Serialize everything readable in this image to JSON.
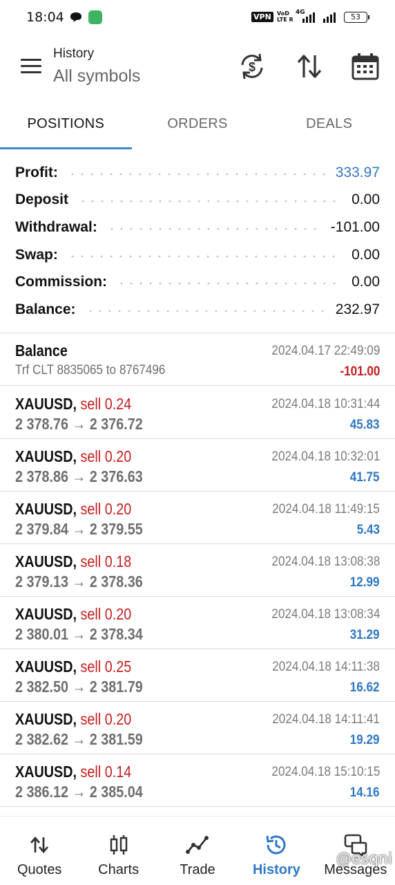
{
  "status_bar": {
    "time": "18:04",
    "vpn": "VPN",
    "volte_top": "VoD",
    "volte_bottom": "LTE R",
    "network": "4G",
    "battery": "53"
  },
  "header": {
    "subtitle": "History",
    "title": "All symbols",
    "icons": [
      "menu-icon",
      "currency-exchange-icon",
      "sort-icon",
      "calendar-icon"
    ]
  },
  "tabs": [
    {
      "label": "POSITIONS",
      "active": true
    },
    {
      "label": "ORDERS",
      "active": false
    },
    {
      "label": "DEALS",
      "active": false
    }
  ],
  "summary": [
    {
      "label": "Profit:",
      "value": "333.97",
      "highlight": true
    },
    {
      "label": "Deposit",
      "value": "0.00"
    },
    {
      "label": "Withdrawal:",
      "value": "-101.00"
    },
    {
      "label": "Swap:",
      "value": "0.00"
    },
    {
      "label": "Commission:",
      "value": "0.00"
    },
    {
      "label": "Balance:",
      "value": "232.97"
    }
  ],
  "balance_entry": {
    "title": "Balance",
    "comment": "Trf CLT 8835065 to 8767496",
    "time": "2024.04.17 22:49:09",
    "amount": "-101.00"
  },
  "deals": [
    {
      "symbol": "XAUUSD,",
      "type": "sell 0.24",
      "prices": "2 378.76 → 2 376.72",
      "time": "2024.04.18 10:31:44",
      "profit": "45.83"
    },
    {
      "symbol": "XAUUSD,",
      "type": "sell 0.20",
      "prices": "2 378.86 → 2 376.63",
      "time": "2024.04.18 10:32:01",
      "profit": "41.75"
    },
    {
      "symbol": "XAUUSD,",
      "type": "sell 0.20",
      "prices": "2 379.84 → 2 379.55",
      "time": "2024.04.18 11:49:15",
      "profit": "5.43"
    },
    {
      "symbol": "XAUUSD,",
      "type": "sell 0.18",
      "prices": "2 379.13 → 2 378.36",
      "time": "2024.04.18 13:08:38",
      "profit": "12.99"
    },
    {
      "symbol": "XAUUSD,",
      "type": "sell 0.20",
      "prices": "2 380.01 → 2 378.34",
      "time": "2024.04.18 13:08:34",
      "profit": "31.29"
    },
    {
      "symbol": "XAUUSD,",
      "type": "sell 0.25",
      "prices": "2 382.50 → 2 381.79",
      "time": "2024.04.18 14:11:38",
      "profit": "16.62"
    },
    {
      "symbol": "XAUUSD,",
      "type": "sell 0.20",
      "prices": "2 382.62 → 2 381.59",
      "time": "2024.04.18 14:11:41",
      "profit": "19.29"
    },
    {
      "symbol": "XAUUSD,",
      "type": "sell 0.14",
      "prices": "2 386.12 → 2 385.04",
      "time": "2024.04.18 15:10:15",
      "profit": "14.16"
    }
  ],
  "bottom_nav": [
    {
      "label": "Quotes",
      "icon": "quotes-icon",
      "active": false
    },
    {
      "label": "Charts",
      "icon": "charts-icon",
      "active": false
    },
    {
      "label": "Trade",
      "icon": "trade-icon",
      "active": false
    },
    {
      "label": "History",
      "icon": "history-icon",
      "active": true
    },
    {
      "label": "Messages",
      "icon": "messages-icon",
      "active": false
    }
  ],
  "watermark": "@esqni",
  "colors": {
    "accent": "#2d77c4",
    "sell": "#c41d1d",
    "tab_indicator": "#3d87d1"
  }
}
